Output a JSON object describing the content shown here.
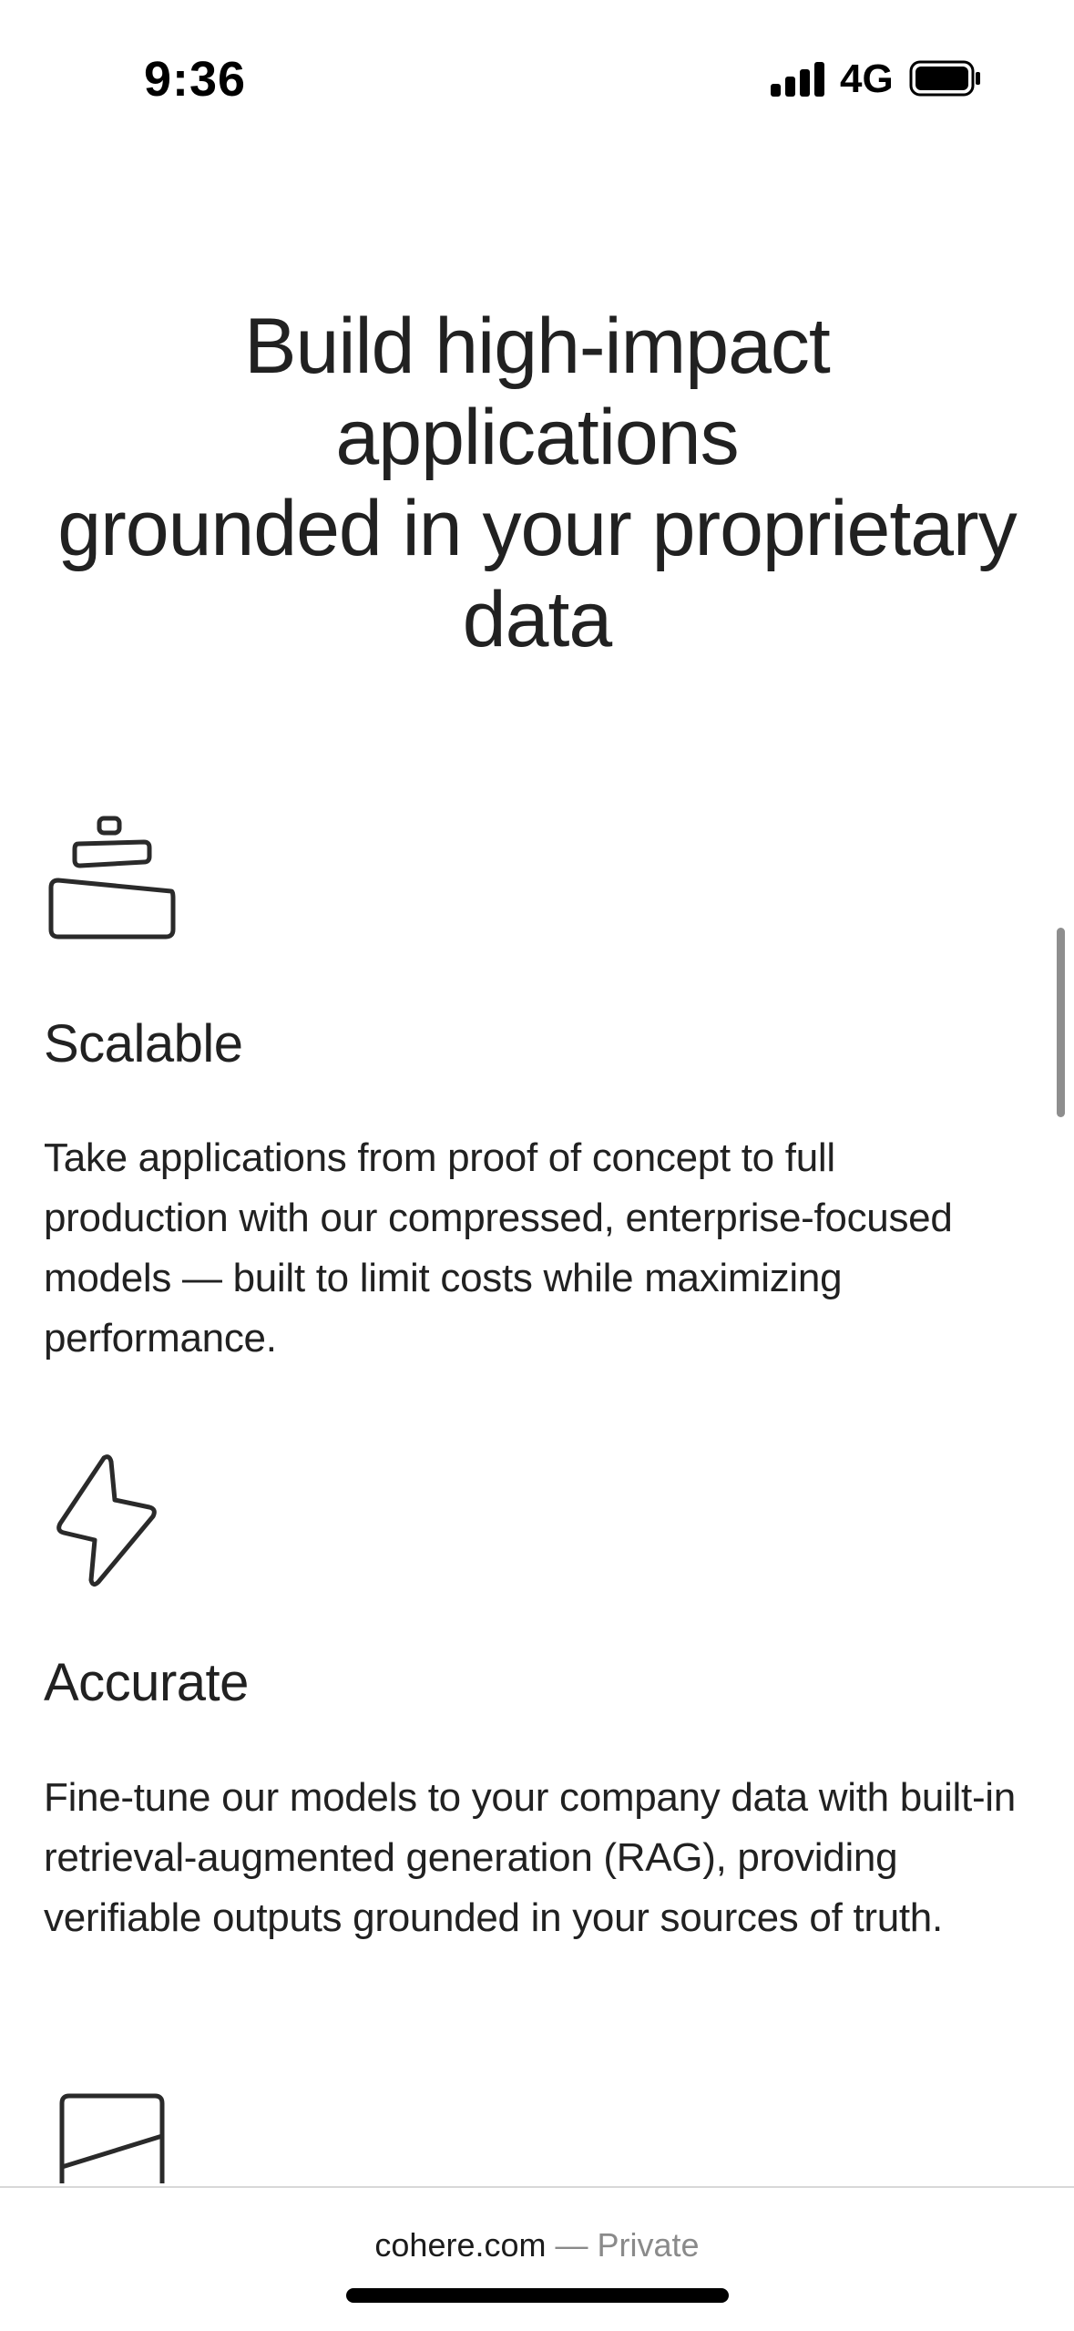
{
  "status_bar": {
    "time": "9:36",
    "network": "4G",
    "icons": [
      "signal-icon",
      "battery-icon"
    ]
  },
  "hero": {
    "lines": [
      "Build high-impact",
      "applications",
      "grounded in your proprietary",
      "data"
    ]
  },
  "features": [
    {
      "icon": "stacked-stones-icon",
      "title": "Scalable",
      "description": "Take applications from proof of concept to full production with our compressed, enterprise-focused models — built to limit costs while maximizing performance."
    },
    {
      "icon": "lightning-bolt-icon",
      "title": "Accurate",
      "description": "Fine-tune our models to your company data with built-in retrieval-augmented generation (RAG), providing verifiable outputs grounded in your sources of truth."
    },
    {
      "icon": "shield-icon",
      "title": "",
      "description": ""
    }
  ],
  "browser": {
    "domain": "cohere.com",
    "separator": "—",
    "mode": "Private"
  },
  "colors": {
    "text": "#212121",
    "muted": "#8a8a8a",
    "background": "#ffffff"
  }
}
